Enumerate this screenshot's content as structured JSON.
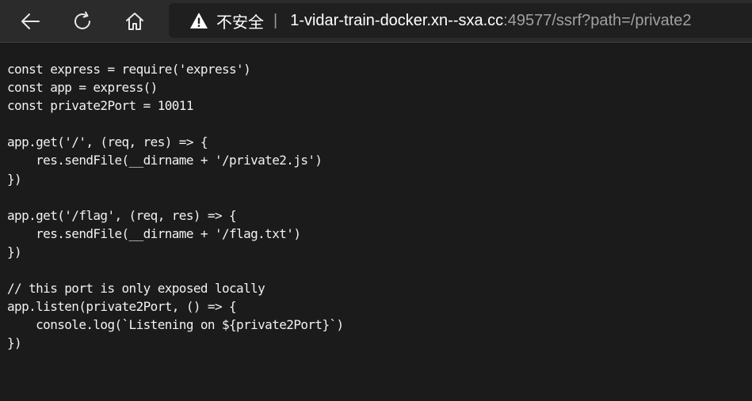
{
  "toolbar": {
    "back_icon": "back-arrow-icon",
    "refresh_icon": "refresh-icon",
    "home_icon": "home-icon"
  },
  "address_bar": {
    "security_icon": "warning-icon",
    "security_label": "不安全",
    "separator": "|",
    "url_host": "1-vidar-train-docker.xn--sxa.cc",
    "url_rest": ":49577/ssrf?path=/private2"
  },
  "page": {
    "source_code": "const express = require('express')\nconst app = express()\nconst private2Port = 10011\n\napp.get('/', (req, res) => {\n    res.sendFile(__dirname + '/private2.js')\n})\n\napp.get('/flag', (req, res) => {\n    res.sendFile(__dirname + '/flag.txt')\n})\n\n// this port is only exposed locally\napp.listen(private2Port, () => {\n    console.log(`Listening on ${private2Port}`)\n})"
  },
  "colors": {
    "toolbar_bg": "#2b2b2b",
    "address_bg": "#1f1f1f",
    "page_bg": "#1b1b1b",
    "text": "#f2f2f2",
    "url_dim": "#a0a0a0"
  }
}
